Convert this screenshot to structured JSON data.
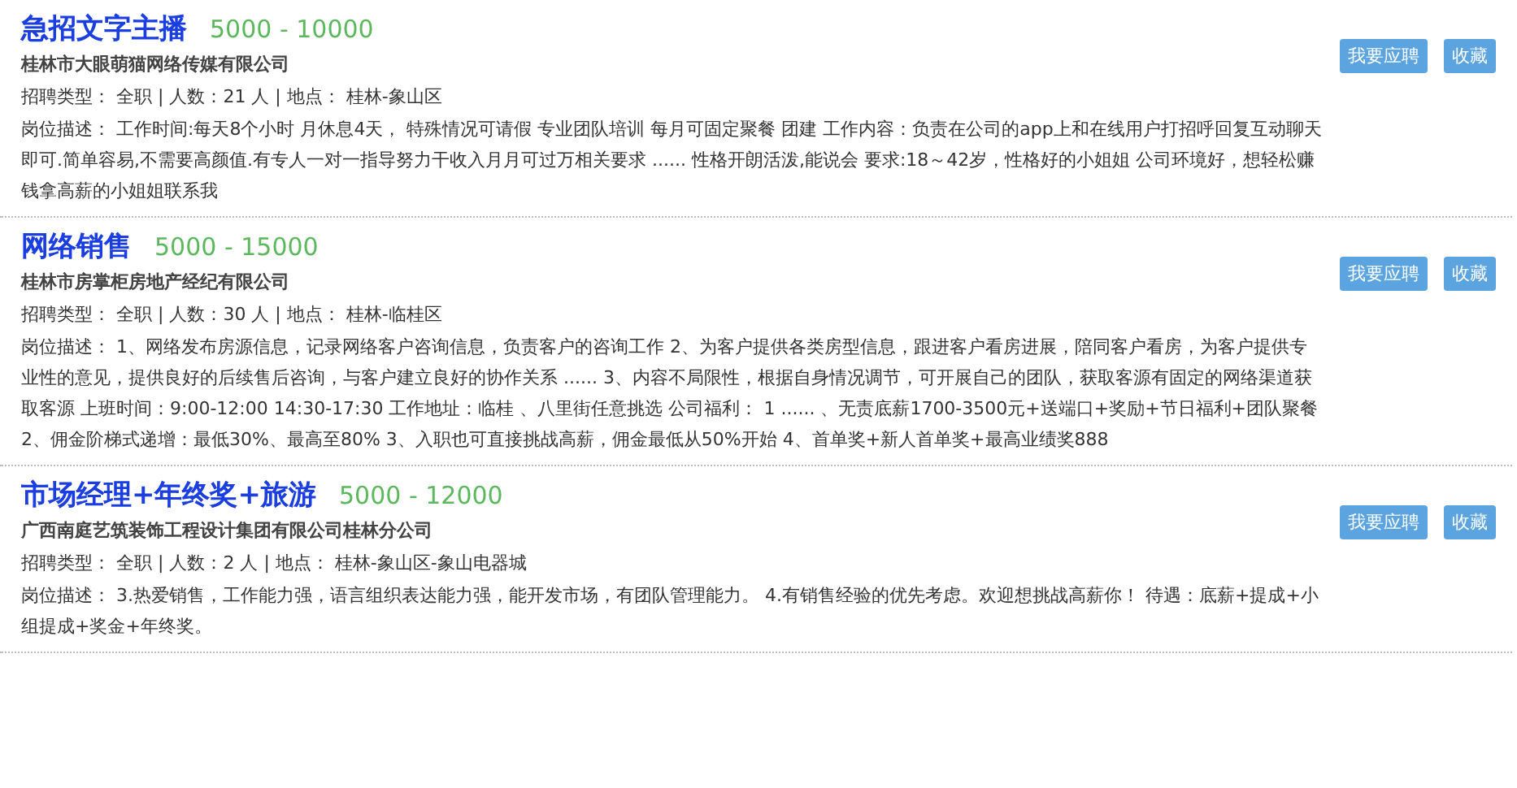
{
  "jobs": [
    {
      "title": "急招文字主播",
      "salary": "5000 - 10000",
      "company": "桂林市大眼萌猫网络传媒有限公司",
      "info": "招聘类型： 全职 | 人数：21 人 | 地点： 桂林-象山区",
      "description": "岗位描述： 工作时间:每天8个小时 月休息4天， 特殊情况可请假 专业团队培训 每月可固定聚餐 团建 工作内容：负责在公司的app上和在线用户打招呼回复互动聊天即可.简单容易,不需要高颜值.有专人一对一指导努力干收入月月可过万相关要求 ...... 性格开朗活泼,能说会 要求:18～42岁，性格好的小姐姐 公司环境好，想轻松赚钱拿高薪的小姐姐联系我",
      "apply": "我要应聘",
      "save": "收藏"
    },
    {
      "title": "网络销售",
      "salary": "5000 - 15000",
      "company": "桂林市房掌柜房地产经纪有限公司",
      "info": "招聘类型： 全职 | 人数：30 人 | 地点： 桂林-临桂区",
      "description": "岗位描述： 1、网络发布房源信息，记录网络客户咨询信息，负责客户的咨询工作 2、为客户提供各类房型信息，跟进客户看房进展，陪同客户看房，为客户提供专业性的意见，提供良好的后续售后咨询，与客户建立良好的协作关系 ...... 3、内容不局限性，根据自身情况调节，可开展自己的团队，获取客源有固定的网络渠道获取客源 上班时间：9:00-12:00 14:30-17:30 工作地址：临桂 、八里街任意挑选 公司福利： 1 ...... 、无责底薪1700-3500元+送端口+奖励+节日福利+团队聚餐 2、佣金阶梯式递增：最低30%、最高至80% 3、入职也可直接挑战高薪，佣金最低从50%开始 4、首单奖+新人首单奖+最高业绩奖888",
      "apply": "我要应聘",
      "save": "收藏"
    },
    {
      "title": "市场经理+年终奖+旅游",
      "salary": "5000 - 12000",
      "company": "广西南庭艺筑装饰工程设计集团有限公司桂林分公司",
      "info": "招聘类型： 全职 | 人数：2 人 | 地点： 桂林-象山区-象山电器城",
      "description": "岗位描述： 3.热爱销售，工作能力强，语言组织表达能力强，能开发市场，有团队管理能力。 4.有销售经验的优先考虑。欢迎想挑战高薪你！ 待遇：底薪+提成+小组提成+奖金+年终奖。",
      "apply": "我要应聘",
      "save": "收藏"
    }
  ]
}
